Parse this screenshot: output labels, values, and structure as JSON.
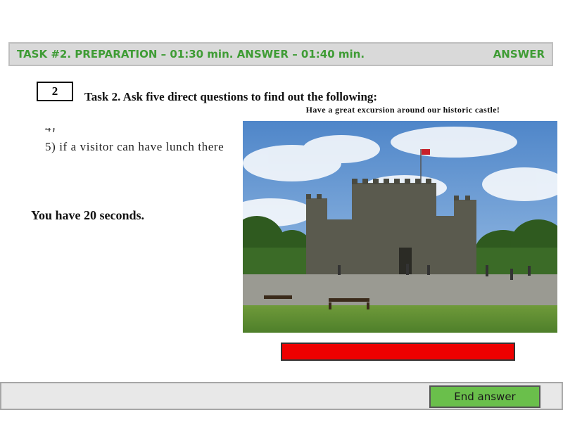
{
  "header": {
    "title": "TASK #2. PREPARATION – 01:30 min. ANSWER – 01:40 min.",
    "answer_label": "ANSWER"
  },
  "task": {
    "number": "2",
    "instruction": "Task 2.  Ask five direct questions to find out the following:",
    "question_5": "5) if a visitor can have lunch there"
  },
  "timer_note": "You have 20 seconds.",
  "poster": {
    "caption": "Have a great excursion around our historic castle!"
  },
  "footer": {
    "end_button_label": "End answer"
  },
  "colors": {
    "header_text": "#3f9c35",
    "progress_bar": "#ee0000",
    "end_button": "#6abf4b"
  }
}
